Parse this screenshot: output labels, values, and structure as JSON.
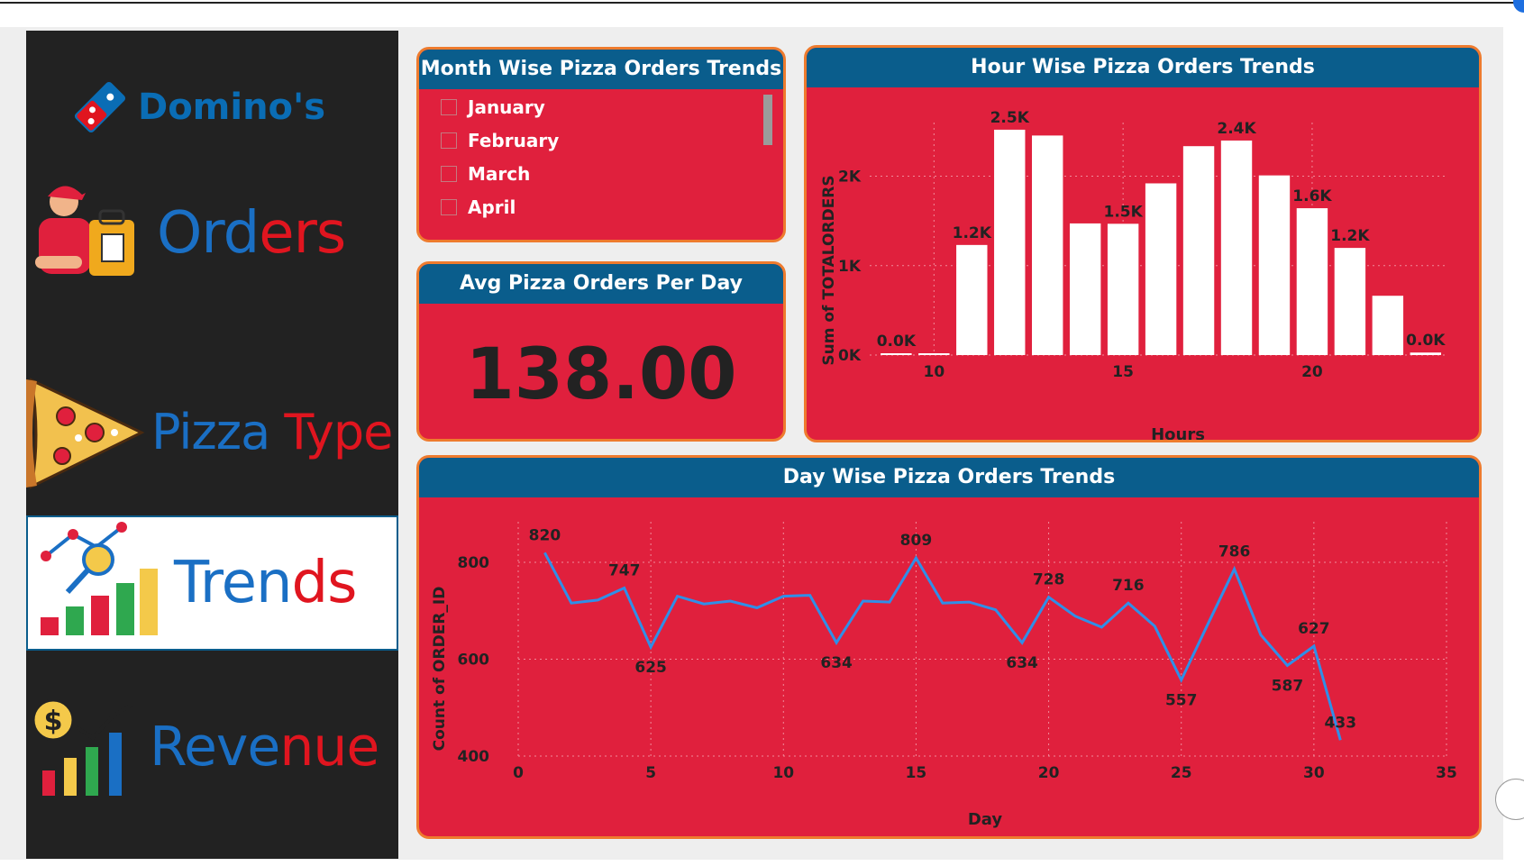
{
  "sidebar": {
    "brand": "Domino's",
    "items": [
      {
        "part1": "Ord",
        "part2": "ers",
        "icon": "delivery-person-icon"
      },
      {
        "part1": "Pizza ",
        "part2": "Type",
        "icon": "pizza-slice-icon"
      },
      {
        "part1": "Tren",
        "part2": "ds",
        "icon": "trend-chart-icon"
      },
      {
        "part1": "Reve",
        "part2": "nue",
        "icon": "revenue-chart-icon"
      }
    ]
  },
  "month_slicer": {
    "title": "Month Wise Pizza Orders Trends",
    "options": [
      "January",
      "February",
      "March",
      "April"
    ]
  },
  "avg_card": {
    "title": "Avg Pizza Orders Per Day",
    "value": "138.00"
  },
  "colors": {
    "card_bg": "#e0203d",
    "card_header": "#0a5d8c",
    "card_border": "#ee7b2e",
    "sidebar_bg": "#222222",
    "bar": "#ffffff",
    "line": "#2f8fe8"
  },
  "chart_data": [
    {
      "type": "bar",
      "title": "Hour Wise Pizza Orders Trends",
      "xlabel": "Hours",
      "ylabel": "Sum of TOTALORDERS",
      "x": [
        9,
        10,
        11,
        12,
        13,
        14,
        15,
        16,
        17,
        18,
        19,
        20,
        21,
        22,
        23
      ],
      "values": [
        4,
        17,
        1231,
        2520,
        2455,
        1472,
        1468,
        1920,
        2336,
        2399,
        2009,
        1642,
        1198,
        663,
        28
      ],
      "data_labels": [
        "0.0K",
        "",
        "1.2K",
        "2.5K",
        "",
        "",
        "1.5K",
        "",
        "",
        "2.4K",
        "",
        "1.6K",
        "1.2K",
        "",
        "0.0K"
      ],
      "x_ticks": [
        10,
        15,
        20
      ],
      "y_ticks": [
        "0K",
        "1K",
        "2K"
      ],
      "ylim": [
        0,
        2600
      ],
      "grid": true
    },
    {
      "type": "line",
      "title": "Day Wise Pizza Orders Trends",
      "xlabel": "Day",
      "ylabel": "Count of ORDER_ID",
      "x": [
        1,
        2,
        3,
        4,
        5,
        6,
        7,
        8,
        9,
        10,
        11,
        12,
        13,
        14,
        15,
        16,
        17,
        18,
        19,
        20,
        21,
        22,
        23,
        24,
        25,
        26,
        27,
        28,
        29,
        30,
        31
      ],
      "values": [
        820,
        716,
        722,
        747,
        625,
        730,
        714,
        720,
        706,
        730,
        732,
        634,
        720,
        718,
        809,
        716,
        718,
        702,
        634,
        728,
        689,
        666,
        716,
        668,
        557,
        672,
        786,
        650,
        587,
        627,
        433
      ],
      "data_labels": [
        "820",
        "",
        "",
        "747",
        "625",
        "",
        "",
        "",
        "",
        "",
        "",
        "634",
        "",
        "",
        "809",
        "",
        "",
        "",
        "634",
        "728",
        "",
        "",
        "716",
        "",
        "557",
        "",
        "786",
        "",
        "587",
        "627",
        "433"
      ],
      "x_ticks": [
        0,
        5,
        10,
        15,
        20,
        25,
        30,
        35
      ],
      "y_ticks": [
        400,
        600,
        800
      ],
      "xlim": [
        0,
        35
      ],
      "ylim": [
        400,
        850
      ],
      "grid": true
    }
  ]
}
